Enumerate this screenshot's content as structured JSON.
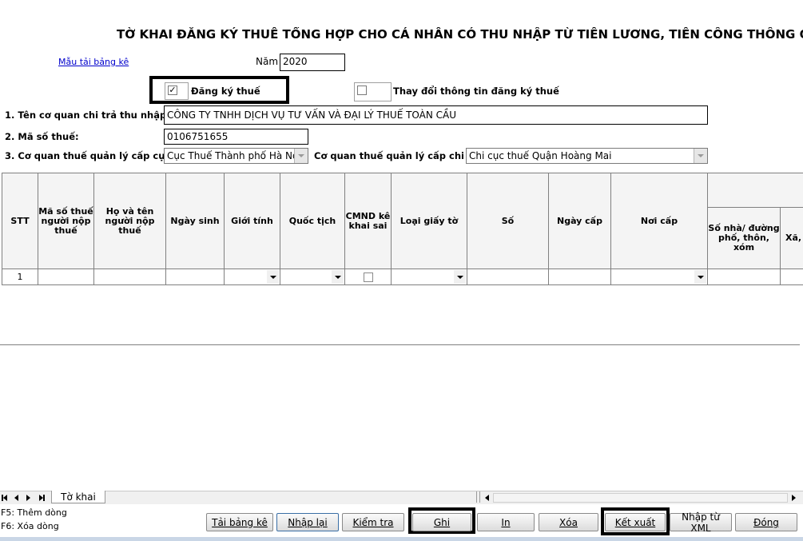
{
  "form": {
    "title": "TỜ KHAI ĐĂNG KÝ THUẾ TỔNG HỢP CHO CÁ NHÂN CÓ THU NHẬP TỪ TIỀN LƯƠNG, TIỀN CÔNG THÔNG QUA CƠ QU",
    "template_link": "Mẫu tải bảng kê",
    "year_label": "Năm",
    "year_value": "2020",
    "register_label": "Đăng ký thuế",
    "register_checked": true,
    "change_label": "Thay đổi thông tin đăng ký thuế",
    "change_checked": false,
    "payer_label": "1. Tên cơ quan chi trả thu nhập:",
    "payer_value": "CÔNG TY TNHH DỊCH VỤ TƯ VẤN VÀ ĐẠI LÝ THUẾ TOÀN CẦU",
    "tax_code_label": "2. Mã số thuế:",
    "tax_code_value": "0106751655",
    "dept_label": "3. Cơ quan thuế quản lý cấp cục:",
    "dept_value": "Cục Thuế Thành phố Hà Nội",
    "subdept_label": "Cơ quan thuế quản lý cấp chi cục:",
    "subdept_value": "Chi cục thuế Quận Hoàng Mai"
  },
  "grid": {
    "headers": [
      "STT",
      "Mã số thuế người nộp thuế",
      "Họ và tên người nộp thuế",
      "Ngày sinh",
      "Giới tính",
      "Quốc tịch",
      "CMND kê khai sai",
      "Loại giấy tờ",
      "Số",
      "Ngày cấp",
      "Nơi cấp",
      "Số nhà/ đường phố, thôn, xóm",
      "Xã,"
    ],
    "rows": [
      {
        "stt": "1"
      }
    ]
  },
  "sheet_tab": "Tờ khai",
  "hints": {
    "add_row": "F5: Thêm dòng",
    "delete_row": "F6: Xóa dòng"
  },
  "buttons": {
    "load_list": "Tải bảng kê",
    "reenter": "Nhập lại",
    "check": "Kiểm tra",
    "save": "Ghi",
    "print": "In",
    "delete": "Xóa",
    "export": "Kết xuất",
    "import_xml": "Nhập từ XML",
    "close": "Đóng"
  }
}
